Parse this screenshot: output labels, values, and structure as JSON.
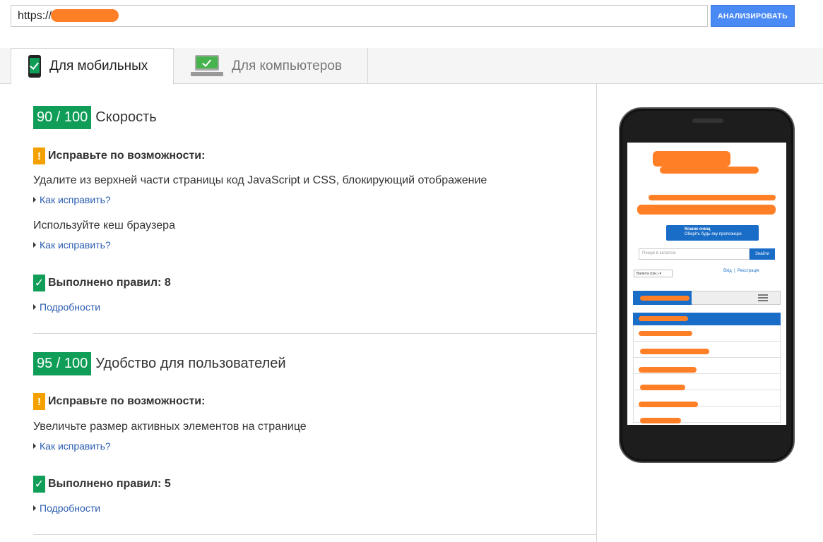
{
  "url_bar": {
    "value": "https://",
    "analyze_label": "АНАЛИЗИРОВАТЬ"
  },
  "tabs": [
    {
      "label": "Для мобильных",
      "icon": "mobile-check-icon",
      "active": true
    },
    {
      "label": "Для компьютеров",
      "icon": "desktop-check-icon",
      "active": false
    }
  ],
  "sections": [
    {
      "score": "90 / 100",
      "title": "Скорость",
      "warn_title": "Исправьте по возможности:",
      "rules": [
        {
          "text": "Удалите из верхней части страницы код JavaScript и CSS, блокирующий отображение",
          "link": "Как исправить?"
        },
        {
          "text": "Используйте кеш браузера",
          "link": "Как исправить?"
        }
      ],
      "passed": "Выполнено правил: 8",
      "details_link": "Подробности"
    },
    {
      "score": "95 / 100",
      "title": "Удобство для пользователей",
      "warn_title": "Исправьте по возможности:",
      "rules": [
        {
          "text": "Увеличьте размер активных элементов на странице",
          "link": "Как исправить?"
        }
      ],
      "passed": "Выполнено правил: 5",
      "details_link": "Подробности"
    }
  ],
  "preview": {
    "cart_title": "Кошик очищ",
    "cart_sub": "Оберіть будь-яку пропозицію",
    "search_placeholder": "Пошук в каталозі",
    "search_button": "Знайти",
    "currency": "Валюта (грн.) ▾",
    "login": "Вхід",
    "register": "Реєстрація"
  },
  "colors": {
    "score_green": "#0f9d58",
    "warn_orange": "#f4a100",
    "link_blue": "#2a5db0",
    "button_blue": "#4a8af4"
  }
}
